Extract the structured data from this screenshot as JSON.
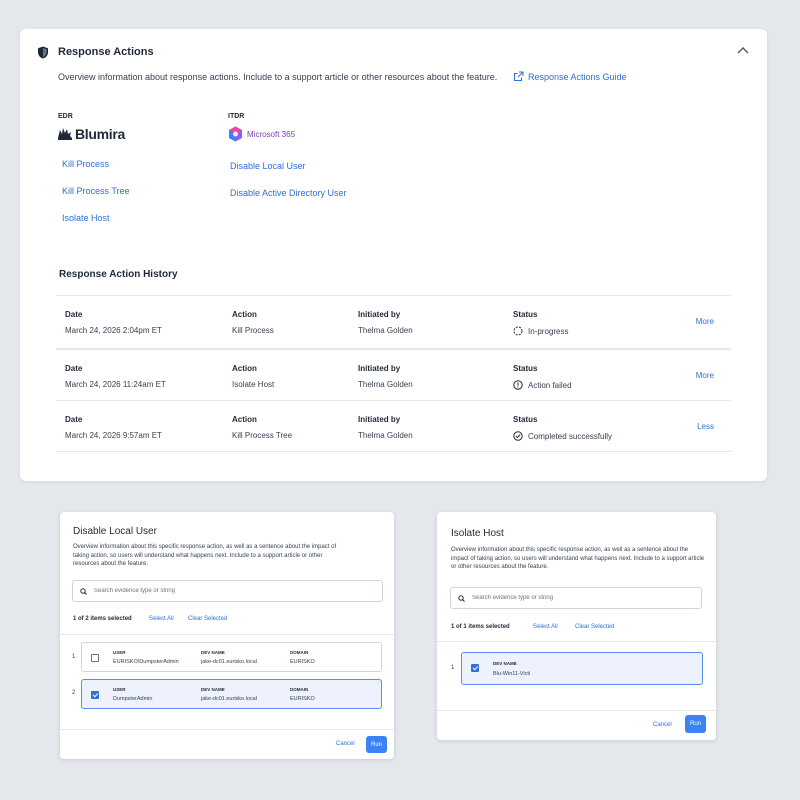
{
  "main": {
    "title": "Response Actions",
    "description": "Overview information about response actions. Include to a support article or other resources about the feature.",
    "guide_link": "Response Actions Guide",
    "edr": {
      "label": "EDR",
      "vendor": "Blumira",
      "actions": [
        "Kill Process",
        "Kill Process Tree",
        "Isolate Host"
      ]
    },
    "itdr": {
      "label": "ITDR",
      "vendor": "Microsoft 365",
      "actions": [
        "Disable Local User",
        "Disable Active Directory User"
      ]
    },
    "history": {
      "title": "Response Action History",
      "headers": {
        "date": "Date",
        "action": "Action",
        "initiated": "Initiated by",
        "status": "Status"
      },
      "rows": [
        {
          "date": "March 24, 2026 2:04pm ET",
          "action": "Kill Process",
          "initiated": "Thelma Golden",
          "status": "In-progress",
          "status_icon": "in-progress-icon",
          "toggle": "More"
        },
        {
          "date": "March 24, 2026 11:24am ET",
          "action": "Isolate Host",
          "initiated": "Thelma Golden",
          "status": "Action failed",
          "status_icon": "alert-circle-icon",
          "toggle": "More"
        },
        {
          "date": "March 24, 2026 9:57am ET",
          "action": "Kill Process Tree",
          "initiated": "Thelma Golden",
          "status": "Completed successfully",
          "status_icon": "check-circle-icon",
          "toggle": "Less"
        }
      ]
    }
  },
  "disable_modal": {
    "title": "Disable Local User",
    "description": "Overview information about this specific response action, as well as a sentence about the impact of taking action, so users will understand what happens next. Include to a support article or other resources about the feature.",
    "search_placeholder": "Search evidence type or string",
    "selected_count": "1 of 2 items selected",
    "select_all": "Select All",
    "clear_selected": "Clear Selected",
    "col_headers": {
      "user": "USER",
      "dev_name": "DEV NAME",
      "domain": "DOMAIN"
    },
    "items": [
      {
        "index": "1",
        "user": "EURISKO\\DumpsterAdmin",
        "dev_name": "jake-dc01.eurisko.local",
        "domain": "EURISKO",
        "checked": false
      },
      {
        "index": "2",
        "user": "DumpsterAdmin",
        "dev_name": "jake-dc01.eurisko.local",
        "domain": "EURISKO",
        "checked": true
      }
    ],
    "cancel": "Cancel",
    "run": "Run"
  },
  "isolate_modal": {
    "title": "Isolate Host",
    "description": "Overview information about this specific response action, as well as a sentence about the impact of taking action, so users will understand what happens next. Include to a support article or other resources about the feature.",
    "search_placeholder": "Search evidence type or string",
    "selected_count": "1 of 1 items selected",
    "select_all": "Select All",
    "clear_selected": "Clear Selected",
    "col_headers": {
      "dev_name": "DEV NAME"
    },
    "items": [
      {
        "index": "1",
        "dev_name": "Blu-Win11-Victi",
        "checked": true
      }
    ],
    "cancel": "Cancel",
    "run": "Run"
  },
  "colors": {
    "accent": "#2f6fd6",
    "run_button": "#3b82f6",
    "selected_bg": "#eef2fc",
    "ms_purple": "#7a3fc2"
  }
}
